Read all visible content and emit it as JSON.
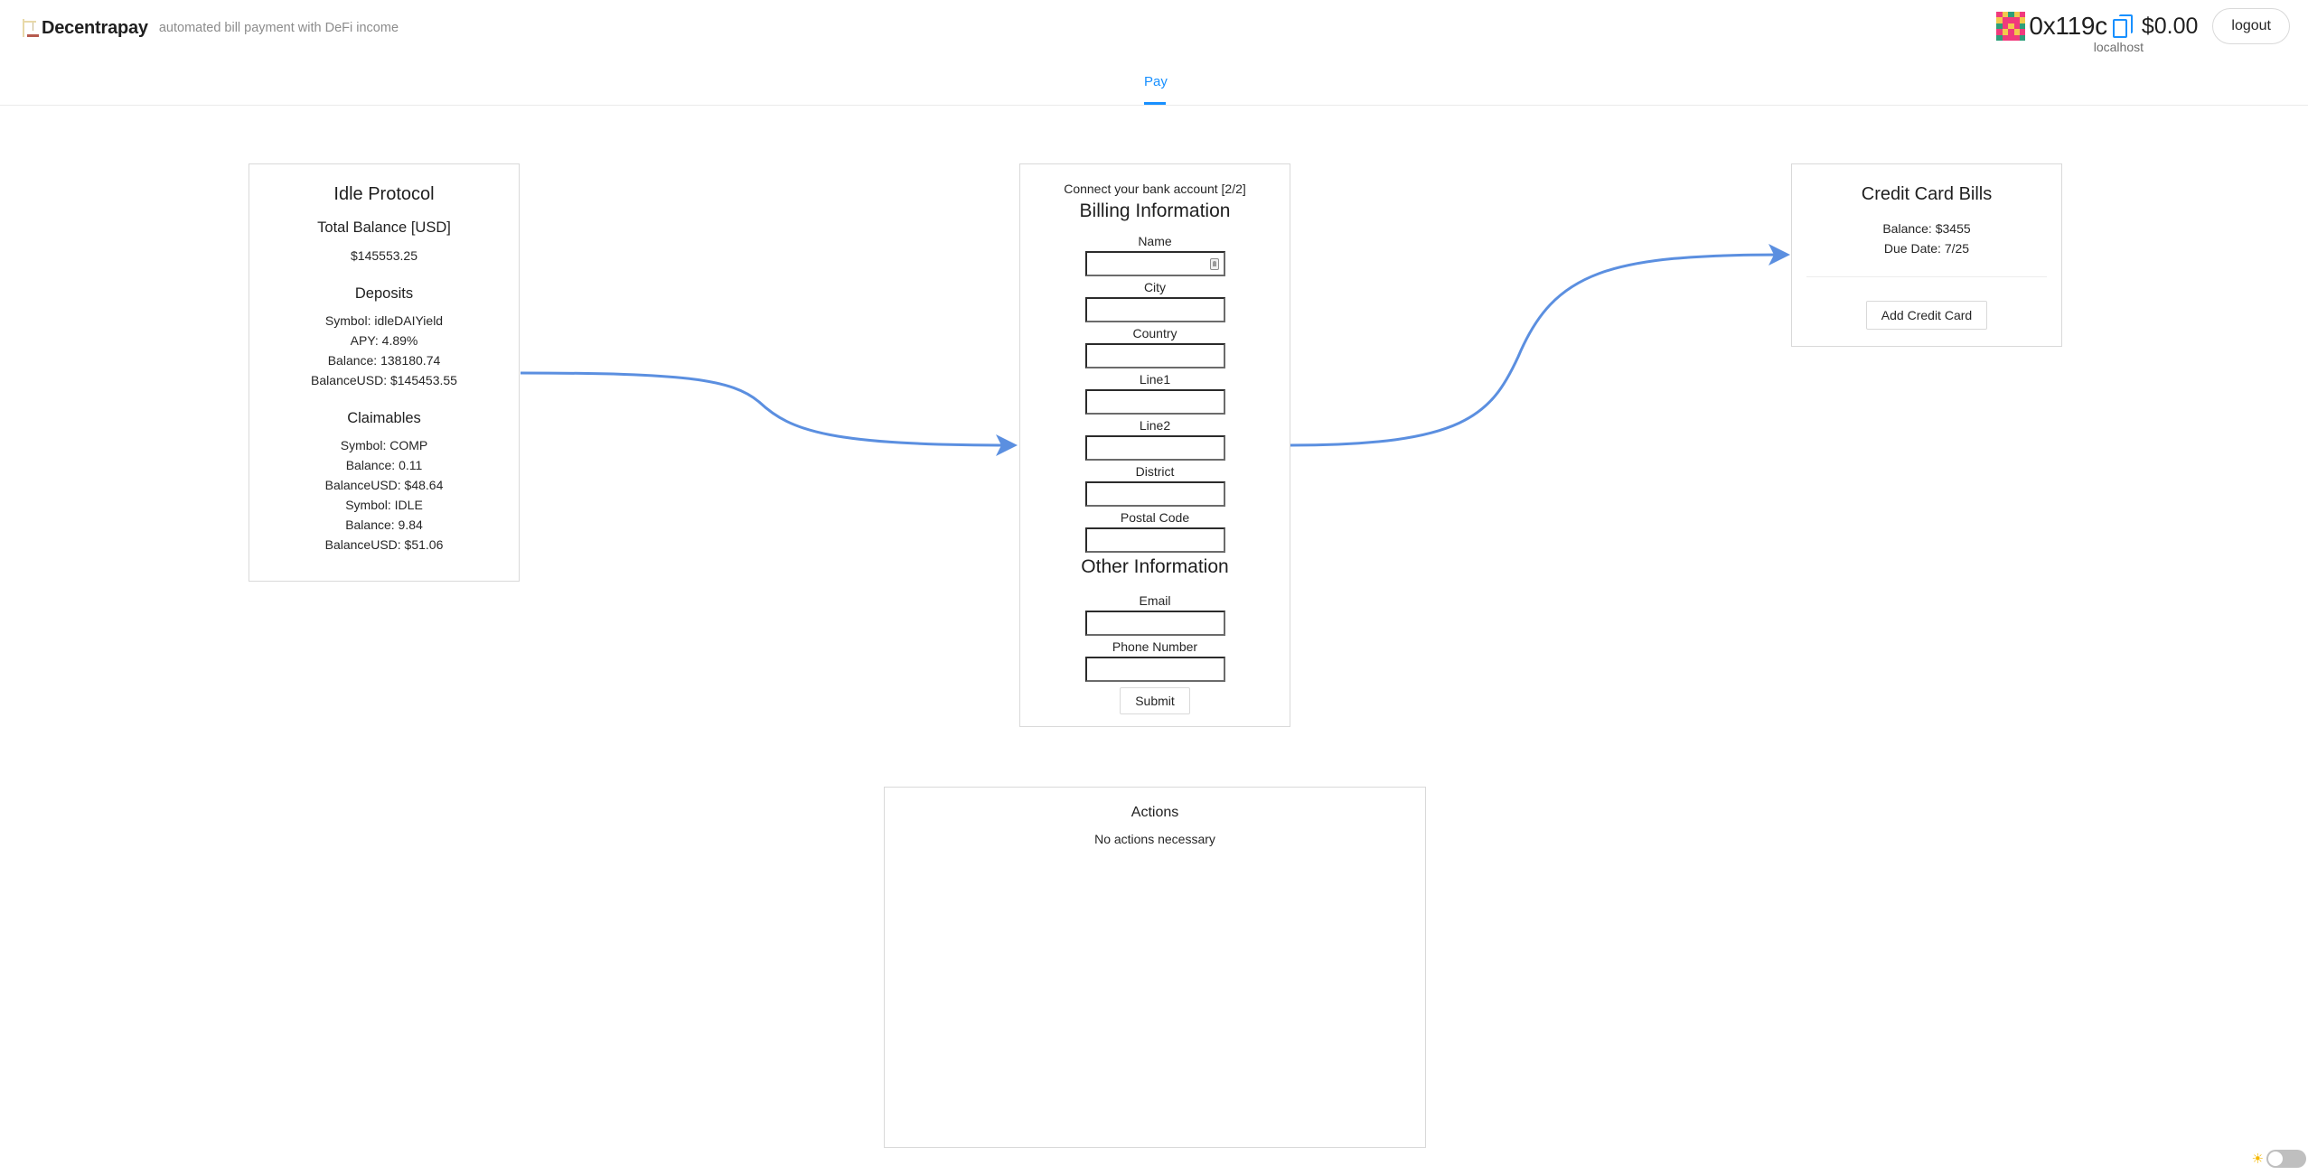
{
  "header": {
    "brand": "Decentrapay",
    "tagline": "automated bill payment with DeFi income",
    "account": {
      "address": "0x119c",
      "balance": "$0.00",
      "network": "localhost",
      "logout_label": "logout",
      "copy_icon": "copy-icon",
      "avatar_icon": "blockie-avatar"
    }
  },
  "tabs": [
    {
      "label": "Pay",
      "active": true
    }
  ],
  "idle_protocol": {
    "title": "Idle Protocol",
    "total_title": "Total Balance [USD]",
    "total_value": "$145553.25",
    "deposits_title": "Deposits",
    "deposits": [
      "Symbol: idleDAIYield",
      "APY: 4.89%",
      "Balance: 138180.74",
      "BalanceUSD: $145453.55"
    ],
    "claimables_title": "Claimables",
    "claimables": [
      "Symbol: COMP",
      "Balance: 0.11",
      "BalanceUSD: $48.64",
      "Symbol: IDLE",
      "Balance: 9.84",
      "BalanceUSD: $51.06"
    ]
  },
  "billing": {
    "step": "Connect your bank account [2/2]",
    "billing_title": "Billing Information",
    "billing_fields": [
      {
        "label": "Name",
        "value": "",
        "has_contact_icon": true
      },
      {
        "label": "City",
        "value": ""
      },
      {
        "label": "Country",
        "value": ""
      },
      {
        "label": "Line1",
        "value": ""
      },
      {
        "label": "Line2",
        "value": ""
      },
      {
        "label": "District",
        "value": ""
      },
      {
        "label": "Postal Code",
        "value": ""
      }
    ],
    "other_title": "Other Information",
    "other_fields": [
      {
        "label": "Email",
        "value": ""
      },
      {
        "label": "Phone Number",
        "value": ""
      }
    ],
    "submit_label": "Submit"
  },
  "credit_card": {
    "title": "Credit Card Bills",
    "balance": "Balance: $3455",
    "due_date": "Due Date: 7/25",
    "add_label": "Add Credit Card"
  },
  "actions": {
    "title": "Actions",
    "message": "No actions necessary"
  },
  "theme": {
    "mode": "light",
    "icon": "sun-icon"
  },
  "colors": {
    "accent": "#1890ff",
    "flow_arrow": "#5b8fe0",
    "border": "#d9d9d9"
  }
}
